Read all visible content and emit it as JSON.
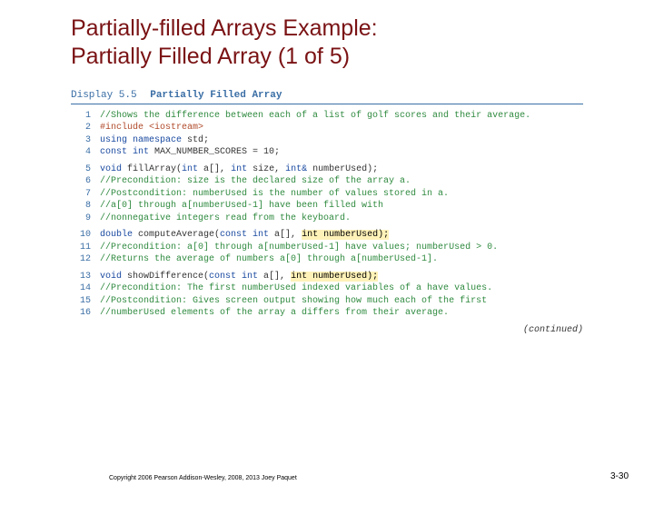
{
  "title_line1": "Partially-filled Arrays Example:",
  "title_line2": "Partially Filled Array (1 of 5)",
  "display": {
    "label": "Display 5.5",
    "title": "Partially Filled Array"
  },
  "lines": {
    "l1": "//Shows the difference between each of a list of golf scores and their average.",
    "l2": "#include <iostream>",
    "l3_kw": "using namespace ",
    "l3_id": "std;",
    "l4_kw": "const int ",
    "l4_rest": "MAX_NUMBER_SCORES = 10;",
    "l5_kw": "void ",
    "l5_fn": "fillArray(",
    "l5_p1": "int ",
    "l5_p1b": "a[], ",
    "l5_p2": "int ",
    "l5_p2b": "size, ",
    "l5_p3": "int& ",
    "l5_p3b": "numberUsed);",
    "l6": "//Precondition: size is the declared size of the array a.",
    "l7": "//Postcondition: numberUsed is the number of values stored in a.",
    "l8": "//a[0] through a[numberUsed-1] have been filled with",
    "l9": "//nonnegative integers read from the keyboard.",
    "l10_kw": "double ",
    "l10_fn": "computeAverage(",
    "l10_p1": "const int ",
    "l10_p1b": "a[], ",
    "l10_hl": "int numberUsed);",
    "l11": "//Precondition: a[0] through a[numberUsed-1] have values; numberUsed > 0.",
    "l12": "//Returns the average of numbers a[0] through a[numberUsed-1].",
    "l13_kw": "void ",
    "l13_fn": "showDifference(",
    "l13_p1": "const int ",
    "l13_p1b": "a[], ",
    "l13_hl": "int numberUsed);",
    "l14": "//Precondition: The first numberUsed indexed variables of a have values.",
    "l15": "//Postcondition: Gives screen output showing how much each of the first",
    "l16": "//numberUsed elements of the array a differs from their average."
  },
  "continued": "(continued)",
  "copyright": "Copyright 2006 Pearson Addison-Wesley, 2008, 2013 Joey Paquet",
  "page": "3-30"
}
